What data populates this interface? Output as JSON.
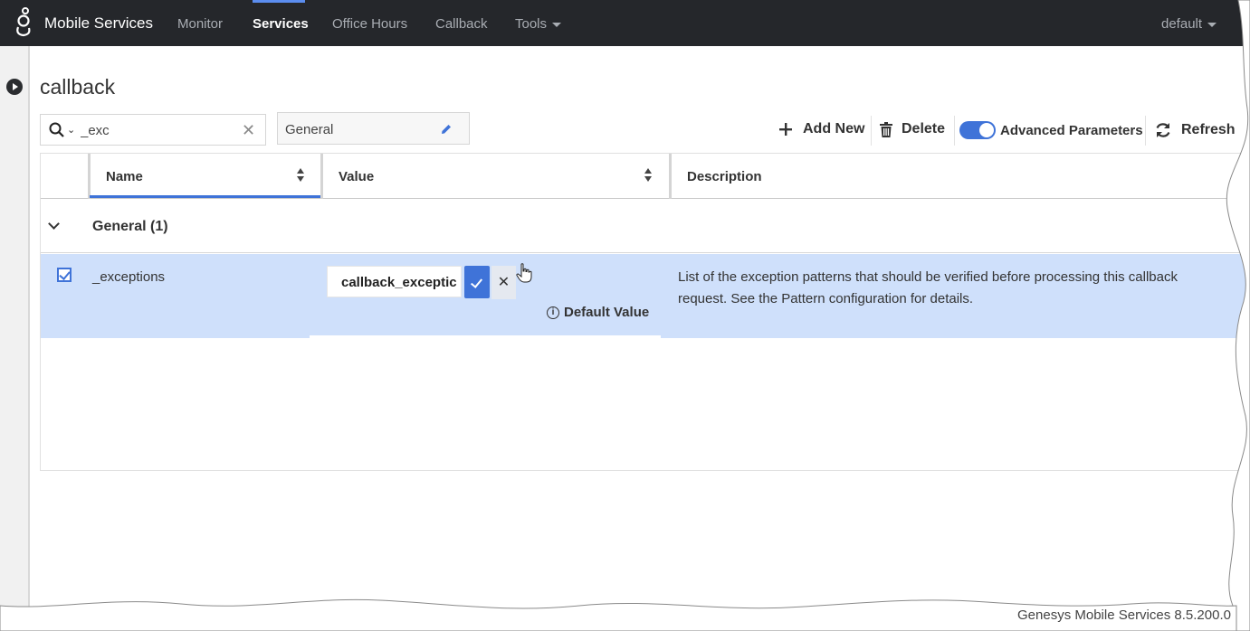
{
  "navbar": {
    "brand": "Mobile Services",
    "items": [
      {
        "label": "Monitor"
      },
      {
        "label": "Services"
      },
      {
        "label": "Office Hours"
      },
      {
        "label": "Callback"
      },
      {
        "label": "Tools"
      }
    ],
    "active_item": "Services",
    "account": "default"
  },
  "page": {
    "title": "callback"
  },
  "search": {
    "value": "_exc"
  },
  "group_select": {
    "label": "General"
  },
  "toolbar": {
    "add_new": "Add New",
    "delete": "Delete",
    "advanced": "Advanced Parameters",
    "advanced_on": true,
    "refresh": "Refresh"
  },
  "grid": {
    "columns": [
      "Name",
      "Value",
      "Description"
    ],
    "group": "General (1)",
    "rows": [
      {
        "checked": true,
        "name": "_exceptions",
        "value": "callback_exceptic",
        "default_value_label": "Default Value",
        "description": "List of the exception patterns that should be verified before processing this callback request. See the Pattern configuration for details."
      }
    ]
  },
  "footer": {
    "text": "Genesys Mobile Services 8.5.200.0"
  },
  "colors": {
    "navbar_bg": "#25272b",
    "accent": "#3f73d8",
    "row_selected": "#cfe0fb"
  }
}
